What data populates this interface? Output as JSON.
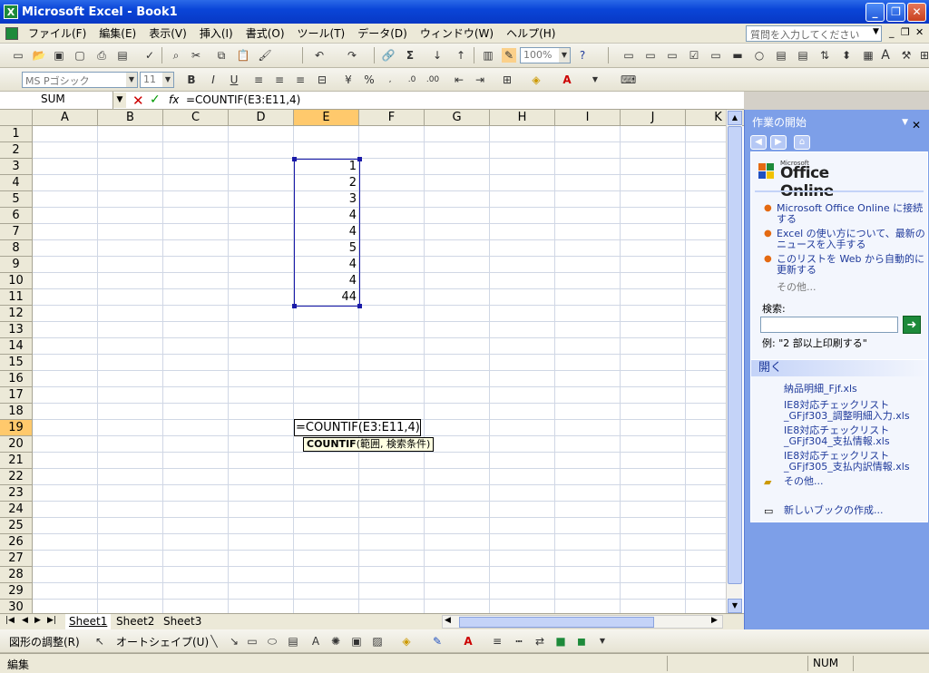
{
  "window": {
    "title": "Microsoft Excel - Book1",
    "app_icon": "excel-icon"
  },
  "menu": {
    "items": [
      "ファイル(F)",
      "編集(E)",
      "表示(V)",
      "挿入(I)",
      "書式(O)",
      "ツール(T)",
      "データ(D)",
      "ウィンドウ(W)",
      "ヘルプ(H)"
    ],
    "ask_placeholder": "質問を入力してください"
  },
  "toolbar": {
    "zoom": "100%"
  },
  "format_toolbar": {
    "font": "MS Pゴシック",
    "size": "11"
  },
  "formula_bar": {
    "name_box": "SUM",
    "formula": "=COUNTIF(E3:E11,4)"
  },
  "grid": {
    "columns": [
      "A",
      "B",
      "C",
      "D",
      "E",
      "F",
      "G",
      "H",
      "I",
      "J",
      "K"
    ],
    "rows": [
      "1",
      "2",
      "3",
      "4",
      "5",
      "6",
      "7",
      "8",
      "9",
      "10",
      "11",
      "12",
      "13",
      "14",
      "15",
      "16",
      "17",
      "18",
      "19",
      "20",
      "21",
      "22",
      "23",
      "24",
      "25",
      "26",
      "27",
      "28",
      "29",
      "30"
    ],
    "selected_column": "E",
    "selected_row": "19",
    "e_values": [
      "1",
      "2",
      "3",
      "4",
      "4",
      "5",
      "4",
      "4",
      "44"
    ],
    "edit_text": "=COUNTIF(E3:E11,4)",
    "tooltip_func": "COUNTIF",
    "tooltip_args": "(範囲, 検索条件)"
  },
  "sheets": [
    "Sheet1",
    "Sheet2",
    "Sheet3"
  ],
  "status": {
    "mode": "編集",
    "num": "NUM"
  },
  "draw_toolbar": {
    "adjust": "図形の調整(R)",
    "autoshape": "オートシェイプ(U)"
  },
  "taskpane": {
    "title": "作業の開始",
    "brand_small": "Microsoft",
    "brand": "Office Online",
    "links": [
      "Microsoft Office Online に接続する",
      "Excel の使い方について、最新のニュースを入手する",
      "このリストを Web から自動的に更新する"
    ],
    "more": "その他...",
    "search_label": "検索:",
    "search_example": "例: \"2 部以上印刷する\"",
    "open_title": "開く",
    "files": [
      "納品明細_Fjf.xls",
      "IE8対応チェックリスト_GFjf303_調整明細入力.xls",
      "IE8対応チェックリスト_GFjf304_支払情報.xls",
      "IE8対応チェックリスト_GFjf305_支払内訳情報.xls"
    ],
    "open_more": "その他...",
    "new_book": "新しいブックの作成..."
  }
}
